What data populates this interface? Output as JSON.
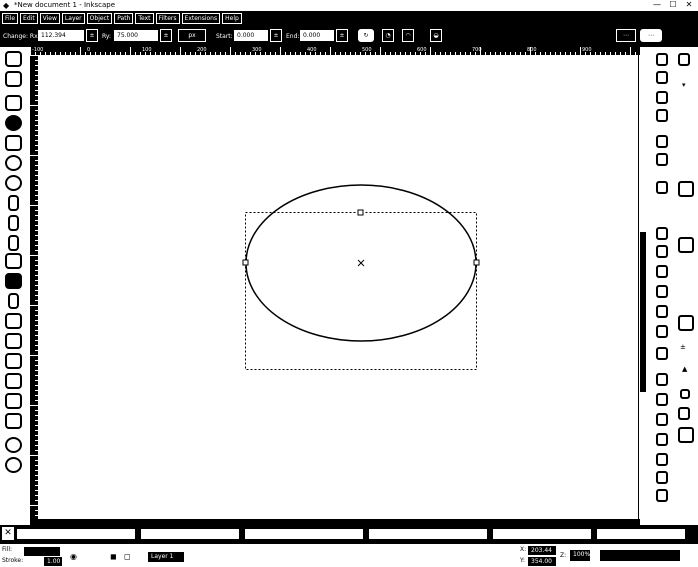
{
  "window": {
    "title": "*New document 1 - Inkscape",
    "minimize_glyph": "—",
    "maximize_glyph": "☐",
    "close_glyph": "✕"
  },
  "menu": {
    "items": [
      "File",
      "Edit",
      "View",
      "Layer",
      "Object",
      "Path",
      "Text",
      "Filters",
      "Extensions",
      "Help"
    ]
  },
  "tool_controls": {
    "change_label": "Change: Rx",
    "rx_value": "112.394",
    "ry_label": "Ry:",
    "ry_value": "75.000",
    "unit": "px",
    "start_label": "Start:",
    "start_value": "0.000",
    "end_label": "End:",
    "end_value": "0.000",
    "reset_label": "↻"
  },
  "ruler": {
    "labels": [
      "-100",
      "0",
      "100",
      "200",
      "300",
      "400",
      "500",
      "600",
      "700",
      "800",
      "900"
    ]
  },
  "palette": {
    "none_glyph": "✕"
  },
  "statusbar": {
    "fill_label": "Fill:",
    "stroke_label": "Stroke:",
    "stroke_value": "1.00",
    "layer_label": "Layer 1",
    "x_label": "X:",
    "x_value": "203.44",
    "y_label": "Y:",
    "y_value": "354.00",
    "z_label": "Z:",
    "zoom_value": "100%"
  },
  "colors": {
    "chrome": "#000000",
    "canvas": "#ffffff",
    "accent": "#000000"
  },
  "icons": {
    "app": "inkscape-logo-icon",
    "tools": [
      "selector-tool-icon",
      "node-tool-icon",
      "zoom-tool-icon",
      "rect-tool-icon",
      "3dbox-tool-icon",
      "ellipse-tool-icon",
      "star-tool-icon",
      "spiral-tool-icon",
      "pencil-tool-icon",
      "pen-tool-icon",
      "calligraphy-tool-icon",
      "text-tool-icon",
      "gradient-tool-icon",
      "mesh-tool-icon",
      "dropper-tool-icon",
      "paint-bucket-tool-icon",
      "tweak-tool-icon",
      "spray-tool-icon",
      "eraser-tool-icon",
      "connector-tool-icon",
      "measure-tool-icon"
    ]
  }
}
